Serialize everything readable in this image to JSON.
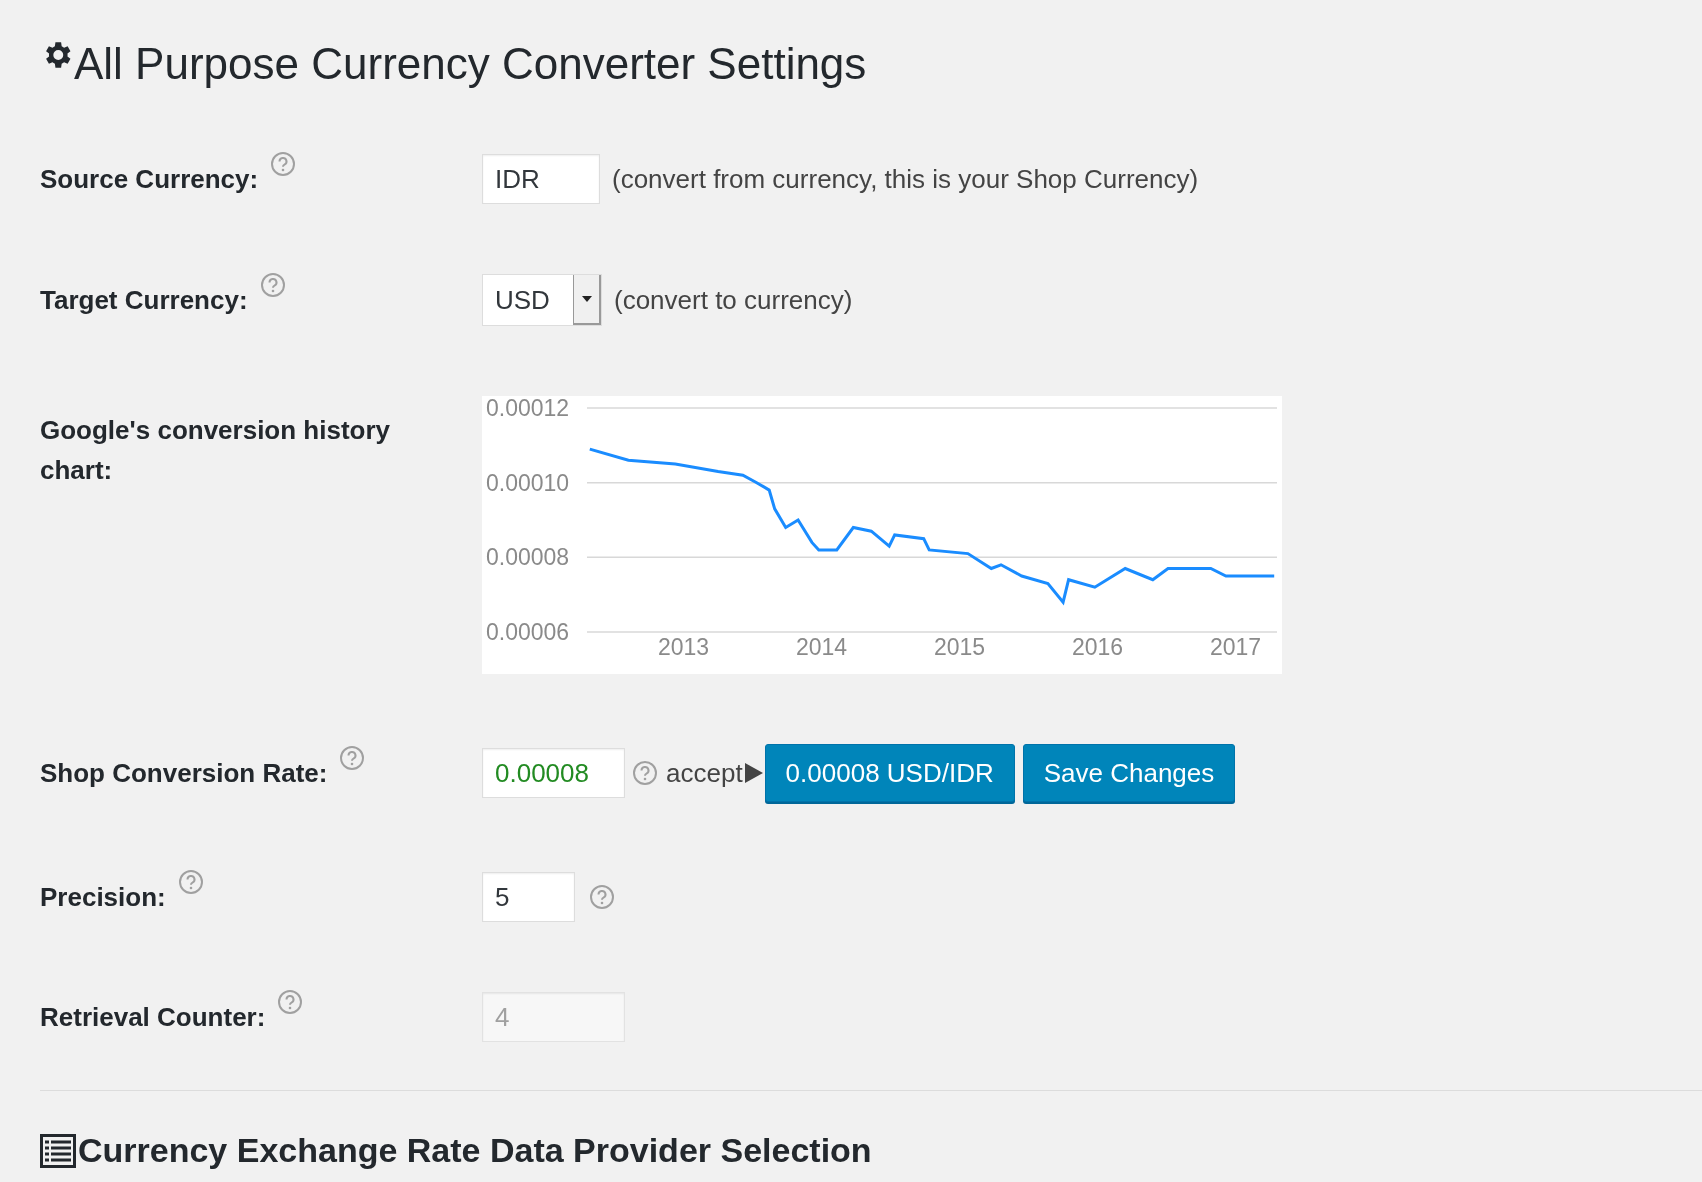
{
  "title": "All Purpose Currency Converter Settings",
  "rows": [
    {
      "kind": "text",
      "label": "Source Currency:",
      "value": "IDR",
      "note": "(convert from currency, this is your Shop Currency)"
    },
    {
      "kind": "select",
      "label": "Target Currency:",
      "value": "USD",
      "note": "(convert to currency)"
    },
    {
      "kind": "chart",
      "label": "Google's conversion history chart:",
      "chart_data": {
        "type": "line",
        "x": [
          2012.32,
          2012.6,
          2012.94,
          2013.25,
          2013.43,
          2013.53,
          2013.62,
          2013.66,
          2013.74,
          2013.83,
          2013.93,
          2013.98,
          2014.11,
          2014.23,
          2014.36,
          2014.49,
          2014.53,
          2014.74,
          2014.78,
          2015.06,
          2015.23,
          2015.3,
          2015.45,
          2015.64,
          2015.75,
          2015.79,
          2015.98,
          2016.2,
          2016.4,
          2016.51,
          2016.82,
          2016.93,
          2017.28
        ],
        "xlim": [
          2012.3,
          2017.3
        ],
        "series": [
          {
            "color": "#1a8cff",
            "values": [
              0.000109,
              0.000106,
              0.000105,
              0.000103,
              0.000102,
              0.0001,
              9.8e-05,
              9.3e-05,
              8.8e-05,
              9e-05,
              8.4e-05,
              8.2e-05,
              8.2e-05,
              8.8e-05,
              8.7e-05,
              8.3e-05,
              8.6e-05,
              8.5e-05,
              8.2e-05,
              8.1e-05,
              7.7e-05,
              7.8e-05,
              7.5e-05,
              7.3e-05,
              6.8e-05,
              7.4e-05,
              7.2e-05,
              7.7e-05,
              7.4e-05,
              7.7e-05,
              7.7e-05,
              7.5e-05,
              7.5e-05
            ]
          }
        ],
        "ylim": [
          6e-05,
          0.00012
        ],
        "yticks": [
          {
            "value": 6e-05,
            "label": "0.00006"
          },
          {
            "value": 8e-05,
            "label": "0.00008"
          },
          {
            "value": 0.0001,
            "label": "0.00010"
          },
          {
            "value": 0.00012,
            "label": "0.00012"
          }
        ],
        "xticks": [
          {
            "value": 2013,
            "label": "2013"
          },
          {
            "value": 2014,
            "label": "2014"
          },
          {
            "value": 2015,
            "label": "2015"
          },
          {
            "value": 2016,
            "label": "2016"
          },
          {
            "value": 2017,
            "label": "2017"
          }
        ]
      }
    },
    {
      "kind": "rate",
      "label": "Shop Conversion Rate:",
      "value": "0.00008",
      "accept": "accept",
      "accept_button": "0.00008 USD/IDR",
      "save_button": "Save Changes"
    },
    {
      "kind": "number",
      "label": "Precision:",
      "value": "5"
    },
    {
      "kind": "counter",
      "label": "Retrieval Counter:",
      "value": "4",
      "disabled": true
    }
  ],
  "section_heading": "Currency Exchange Rate Data Provider Selection"
}
